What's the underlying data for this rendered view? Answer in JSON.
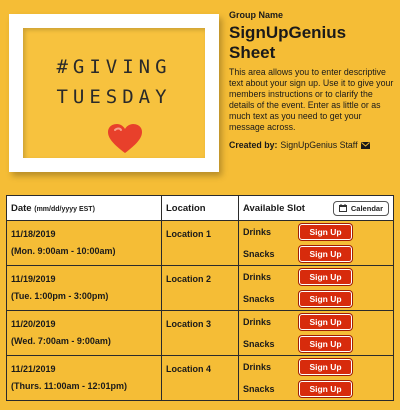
{
  "header": {
    "image_lines": [
      "#GIVING",
      "TUESDAY"
    ],
    "group_label": "Group Name",
    "title": "SignUpGenius Sheet",
    "description": "This area allows you to enter descriptive text about your sign up. Use it to give your members instructions or to clarify the details of the event. Enter as little or as much text as you need to get your message across.",
    "created_by_label": "Created by:",
    "created_by_name": "SignUpGenius Staff",
    "icon": "mail-icon"
  },
  "table": {
    "col_date": "Date",
    "col_date_format": "(mm/dd/yyyy EST)",
    "col_location": "Location",
    "col_slot": "Available Slot",
    "calendar_label": "Calendar",
    "rows": [
      {
        "date": "11/18/2019",
        "time": "(Mon. 9:00am - 10:00am)",
        "location": "Location 1",
        "slots": [
          {
            "name": "Drinks",
            "button": "Sign Up"
          },
          {
            "name": "Snacks",
            "button": "Sign Up"
          }
        ]
      },
      {
        "date": "11/19/2019",
        "time": "(Tue. 1:00pm - 3:00pm)",
        "location": "Location 2",
        "slots": [
          {
            "name": "Drinks",
            "button": "Sign Up"
          },
          {
            "name": "Snacks",
            "button": "Sign Up"
          }
        ]
      },
      {
        "date": "11/20/2019",
        "time": "(Wed. 7:00am - 9:00am)",
        "location": "Location 3",
        "slots": [
          {
            "name": "Drinks",
            "button": "Sign Up"
          },
          {
            "name": "Snacks",
            "button": "Sign Up"
          }
        ]
      },
      {
        "date": "11/21/2019",
        "time": "(Thurs. 11:00am - 12:01pm)",
        "location": "Location 4",
        "slots": [
          {
            "name": "Drinks",
            "button": "Sign Up"
          },
          {
            "name": "Snacks",
            "button": "Sign Up"
          }
        ]
      }
    ]
  },
  "colors": {
    "background": "#f5bd36",
    "signup_button": "#d72b0c",
    "heart": "#e8402b"
  }
}
